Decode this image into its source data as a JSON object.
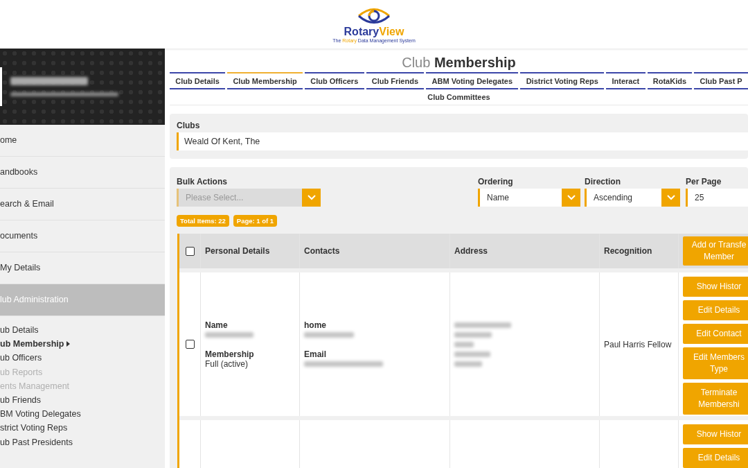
{
  "logo": {
    "name_first": "Rotary",
    "name_second": "View",
    "tagline_before": "The",
    "tagline_accent": "Rotary",
    "tagline_after": "Data Management System"
  },
  "sidebar": {
    "items": [
      {
        "label": "ome",
        "selected": false
      },
      {
        "label": "andbooks",
        "selected": false
      },
      {
        "label": "earch & Email",
        "selected": false
      },
      {
        "label": "ocuments",
        "selected": false
      },
      {
        "label": "My Details",
        "selected": false
      },
      {
        "label": "lub Administration",
        "selected": true
      }
    ],
    "subitems": [
      {
        "label": "ub Details",
        "selected": false,
        "disabled": false
      },
      {
        "label": "ub Membership",
        "selected": true,
        "disabled": false
      },
      {
        "label": "ub Officers",
        "selected": false,
        "disabled": false
      },
      {
        "label": "ub Reports",
        "selected": false,
        "disabled": true
      },
      {
        "label": "ents Management",
        "selected": false,
        "disabled": true
      },
      {
        "label": "ub Friends",
        "selected": false,
        "disabled": false
      },
      {
        "label": "BM Voting Delegates",
        "selected": false,
        "disabled": false
      },
      {
        "label": "strict Voting Reps",
        "selected": false,
        "disabled": false
      },
      {
        "label": "ub Past Presidents",
        "selected": false,
        "disabled": false
      }
    ]
  },
  "page_title": "Club **Membership**",
  "tabs": [
    {
      "label": "Club Details",
      "selected": false
    },
    {
      "label": "Club Membership",
      "selected": true
    },
    {
      "label": "Club Officers",
      "selected": false
    },
    {
      "label": "Club Friends",
      "selected": false
    },
    {
      "label": "ABM Voting Delegates",
      "selected": false
    },
    {
      "label": "District Voting Reps",
      "selected": false
    },
    {
      "label": "Interact",
      "selected": false
    },
    {
      "label": "RotaKids",
      "selected": false
    },
    {
      "label": "Club Past P",
      "selected": false
    }
  ],
  "tabs_row2": [
    {
      "label": "Club Committees",
      "selected": false
    }
  ],
  "clubs": {
    "label": "Clubs",
    "value": "Weald Of Kent, The"
  },
  "filters": {
    "bulk_actions": {
      "label": "Bulk Actions",
      "placeholder": "Please Select..."
    },
    "ordering": {
      "label": "Ordering",
      "value": "Name"
    },
    "direction": {
      "label": "Direction",
      "value": "Ascending"
    },
    "per_page": {
      "label": "Per Page",
      "value": "25"
    }
  },
  "badges": [
    "Total Items: 22",
    "Page: 1 of 1"
  ],
  "table": {
    "columns": [
      "Personal Details",
      "Contacts",
      "Address",
      "Recognition"
    ],
    "header_checked": false,
    "header_button": "Add or Transfe\nMember",
    "rows": [
      {
        "checked": false,
        "name_label": "Name",
        "membership_label": "Membership",
        "membership": "Full (active)",
        "home_label": "home",
        "email_label": "Email",
        "recognition": "Paul Harris Fellow",
        "redacted": true,
        "buttons": [
          "Show Histor",
          "Edit Details",
          "Edit Contact",
          "Edit Members\nType",
          "Terminate\nMembershi"
        ]
      },
      {
        "buttons": [
          "Show Histor",
          "Edit Details"
        ]
      }
    ]
  }
}
